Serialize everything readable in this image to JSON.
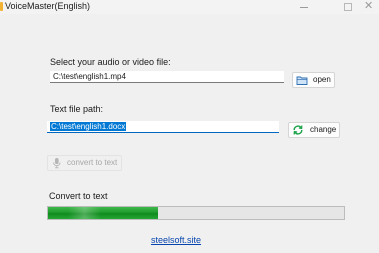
{
  "window": {
    "title": "VoiceMaster(English)",
    "minimize_glyph": "—",
    "close_glyph": "✕"
  },
  "media": {
    "label": "Select your audio or video file:",
    "value": "C:\\test\\english1.mp4",
    "button_label": "open",
    "button_icon": "folder-icon"
  },
  "textfile": {
    "label": "Text file path:",
    "value": "C:\\test\\english1.docx",
    "button_label": "change",
    "button_icon": "refresh-icon"
  },
  "convert": {
    "button_label": "convert to text",
    "button_icon": "microphone-icon",
    "enabled": false
  },
  "progress": {
    "label": "Convert to text",
    "fraction": 0.37,
    "color": "#1f9a2c"
  },
  "footer": {
    "link_text": "steelsoft.site"
  },
  "colors": {
    "accent": "#0078d4",
    "progress_green": "#1f9a2c",
    "link": "#0645ad"
  }
}
